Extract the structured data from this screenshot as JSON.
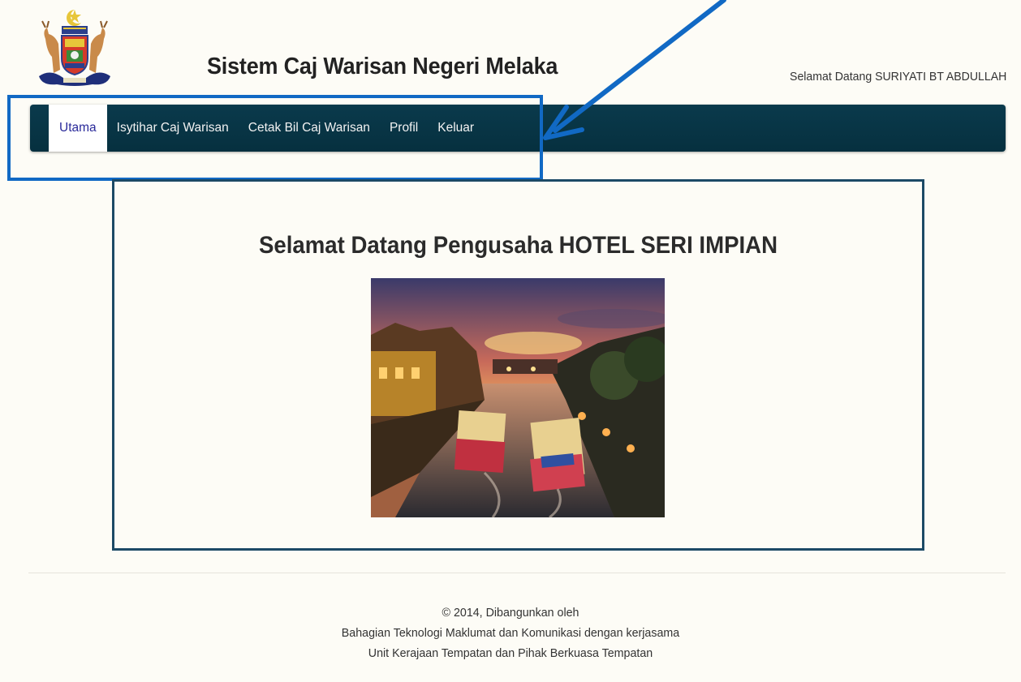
{
  "header": {
    "title": "Sistem Caj Warisan Negeri Melaka",
    "greeting": "Selamat Datang SURIYATI BT ABDULLAH",
    "logo_icon": "melaka-state-crest-icon"
  },
  "nav": {
    "items": [
      {
        "label": "Utama",
        "active": true
      },
      {
        "label": "Isytihar Caj Warisan",
        "active": false
      },
      {
        "label": "Cetak Bil Caj Warisan",
        "active": false
      },
      {
        "label": "Profil",
        "active": false
      },
      {
        "label": "Keluar",
        "active": false
      }
    ]
  },
  "main": {
    "heading": "Selamat Datang Pengusaha HOTEL SERI IMPIAN",
    "image_icon": "melaka-river-photo"
  },
  "footer": {
    "line1": "© 2014, Dibangunkan oleh",
    "line2": "Bahagian Teknologi Maklumat dan Komunikasi dengan kerjasama",
    "line3": "Unit Kerajaan Tempatan dan Pihak Berkuasa Tempatan"
  },
  "colors": {
    "navbar": "#0a3a4c",
    "annotation": "#1169c4",
    "panel_border": "#1c4a66",
    "page_background": "#fdfcf6",
    "active_nav_text": "#2a2a9a"
  }
}
